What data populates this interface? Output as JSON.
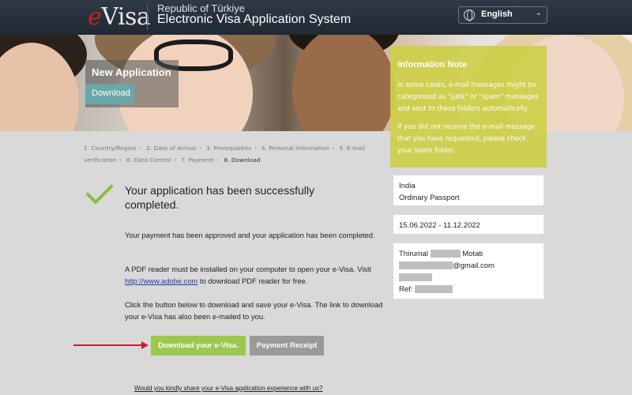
{
  "header": {
    "logo_e": "e",
    "logo_visa": "Visa",
    "republic": "Republic of Türkiye",
    "system": "Electronic Visa Application System",
    "language": "English",
    "language_icon": "globe-icon"
  },
  "banner": {
    "title": "New Application",
    "tab": "Download"
  },
  "info_note": {
    "title": "Information Note",
    "p1": "In some cases, e-mail messages might be categorized as \"junk\" or \"spam\" messages and sent to these folders automatically.",
    "p2": "If you did not receive the e-mail message that you have requested, please check your spam folder."
  },
  "steps": [
    "1. Country/Region",
    "2. Date of Arrival",
    "3. Prerequisites",
    "4. Personal Information",
    "5. E-mail verification",
    "6. Data Control",
    "7. Payment",
    "8. Download"
  ],
  "success": {
    "title": "Your application has been successfully completed.",
    "p1": "Your payment has been approved and your application has been completed.",
    "p2_before": "A PDF reader must be installed on your computer to open your e-Visa. Visit ",
    "p2_link": "http://www.adobe.com",
    "p2_after": " to download PDF reader for free.",
    "p3": "Click the button below to download and save your e-Visa. The link to download your e-Visa has also been e-mailed to you."
  },
  "buttons": {
    "download": "Download your e-Visa.",
    "receipt": "Payment Receipt"
  },
  "survey": "Would you kindly share your e-Visa application experience with us?",
  "cards": {
    "country": "India",
    "passport": "Ordinary Passport",
    "dates": "15.06.2022 - 11.12.2022",
    "first_name": "Thirumal",
    "last_name": "Motati",
    "email_suffix": "@gmail.com",
    "ref_label": "Ref:"
  },
  "colors": {
    "accent_green": "#9dc84f",
    "info_yellow": "#cdcf48",
    "header": "#1f2933"
  }
}
